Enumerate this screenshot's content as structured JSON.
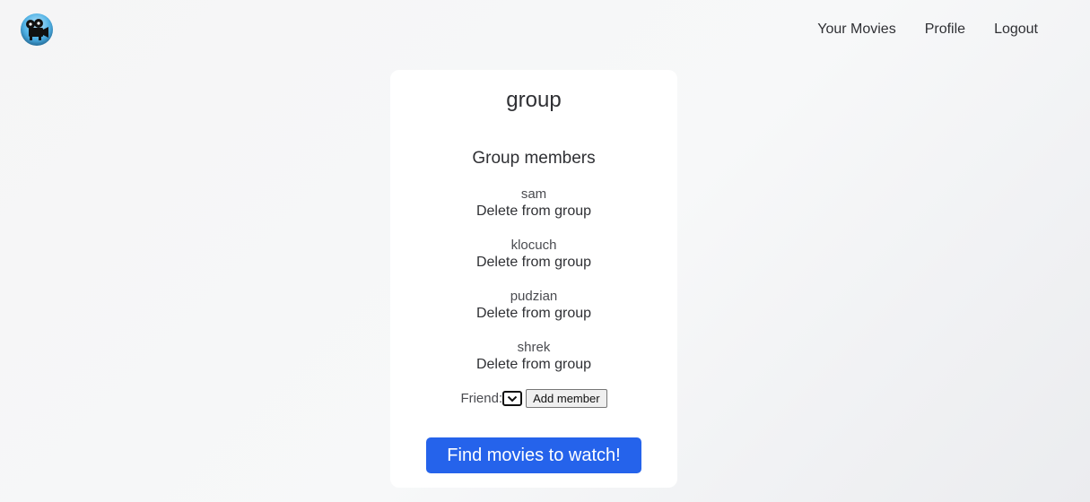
{
  "nav": {
    "items": [
      {
        "label": "Your Movies"
      },
      {
        "label": "Profile"
      },
      {
        "label": "Logout"
      }
    ]
  },
  "logo": {
    "icon": "film-camera-icon"
  },
  "group": {
    "name": "group",
    "members_heading": "Group members",
    "members": [
      {
        "name": "sam",
        "action": "Delete from group"
      },
      {
        "name": "klocuch",
        "action": "Delete from group"
      },
      {
        "name": "pudzian",
        "action": "Delete from group"
      },
      {
        "name": "shrek",
        "action": "Delete from group"
      }
    ],
    "friend_label": "Friend:",
    "friend_select_value": "",
    "add_member_label": "Add member",
    "find_movies_label": "Find movies to watch!"
  },
  "colors": {
    "primary": "#2563eb",
    "card": "#ffffff",
    "text": "#2f3034"
  }
}
